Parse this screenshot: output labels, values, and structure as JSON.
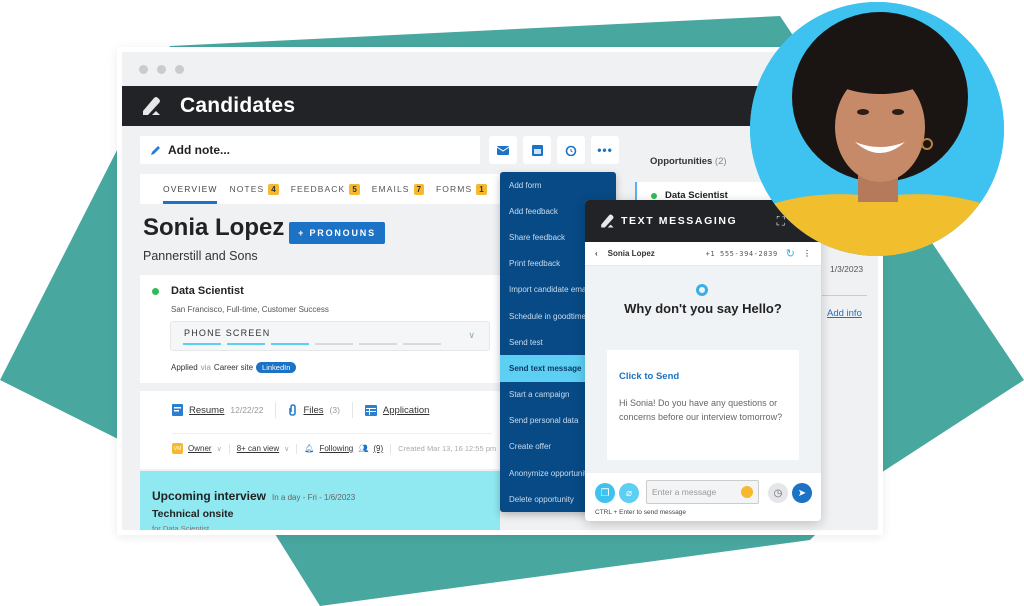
{
  "colors": {
    "teal_bg": "#48a79f",
    "accent_blue": "#1c72c4",
    "dark_bar": "#222326",
    "menu_blue": "#074a85",
    "highlight_cyan": "#5ccff3",
    "badge_yellow": "#f5b82e",
    "interview_bg": "#90e8f0",
    "photo_bg": "#3ec2ef"
  },
  "app": {
    "title": "Candidates",
    "logo_icon": "pencil-icon"
  },
  "toolbar": {
    "add_note_label": "Add note...",
    "buttons": [
      {
        "icon": "mail-icon"
      },
      {
        "icon": "calendar-icon"
      },
      {
        "icon": "alarm-icon"
      },
      {
        "icon": "more-icon"
      }
    ]
  },
  "tabs": [
    {
      "label": "OVERVIEW",
      "active": true
    },
    {
      "label": "NOTES",
      "count": "4"
    },
    {
      "label": "FEEDBACK",
      "count": "5"
    },
    {
      "label": "EMAILS",
      "count": "7"
    },
    {
      "label": "FORMS",
      "count": "1"
    }
  ],
  "candidate": {
    "name": "Sonia Lopez",
    "pronouns_button": "+ PRONOUNS",
    "company": "Pannerstill and Sons"
  },
  "job": {
    "title": "Data Scientist",
    "details": "San Francisco, Full-time, Customer Success",
    "stage": "PHONE SCREEN",
    "stage_progress": "3 of 6",
    "applied_label": "Applied",
    "via_label": "via",
    "source": "Career site",
    "source_tag": "LinkedIn"
  },
  "files": {
    "resume_label": "Resume",
    "resume_date": "12/22/22",
    "files_label": "Files",
    "files_count": "(3)",
    "application_label": "Application"
  },
  "meta": {
    "owner_initials": "VM",
    "owner_label": "Owner",
    "visibility_label": "8+ can view",
    "following_label": "Following",
    "followers_count": "(9)",
    "created": "Created Mar 13, 16 12:55 pm"
  },
  "interview": {
    "title": "Upcoming interview",
    "when": "In a day - Fri - 1/6/2023",
    "type": "Technical onsite",
    "for": "for Data Scientist"
  },
  "opportunities": {
    "label": "Opportunities",
    "count": "(2)",
    "first_title": "Data Scientist",
    "date": "1/3/2023",
    "add_info": "Add info"
  },
  "menu": {
    "items": [
      "Add form",
      "Add feedback",
      "Share feedback",
      "Print feedback",
      "Import candidate emails",
      "Schedule in goodtime",
      "Send test",
      "Send text message",
      "Start a campaign",
      "Send personal data",
      "Create offer",
      "Anonymize opportunity",
      "Delete opportunity"
    ],
    "selected": "Send text message"
  },
  "sms": {
    "title": "TEXT MESSAGING",
    "contact_name": "Sonia Lopez",
    "phone": "+1 555-394-2039",
    "greeting": "Why don't you say Hello?",
    "template_action": "Click to Send",
    "template_message": "Hi Sonia! Do you have any questions or concerns before our interview tomorrow?",
    "input_placeholder": "Enter a message",
    "hint": "CTRL + Enter to send message"
  }
}
